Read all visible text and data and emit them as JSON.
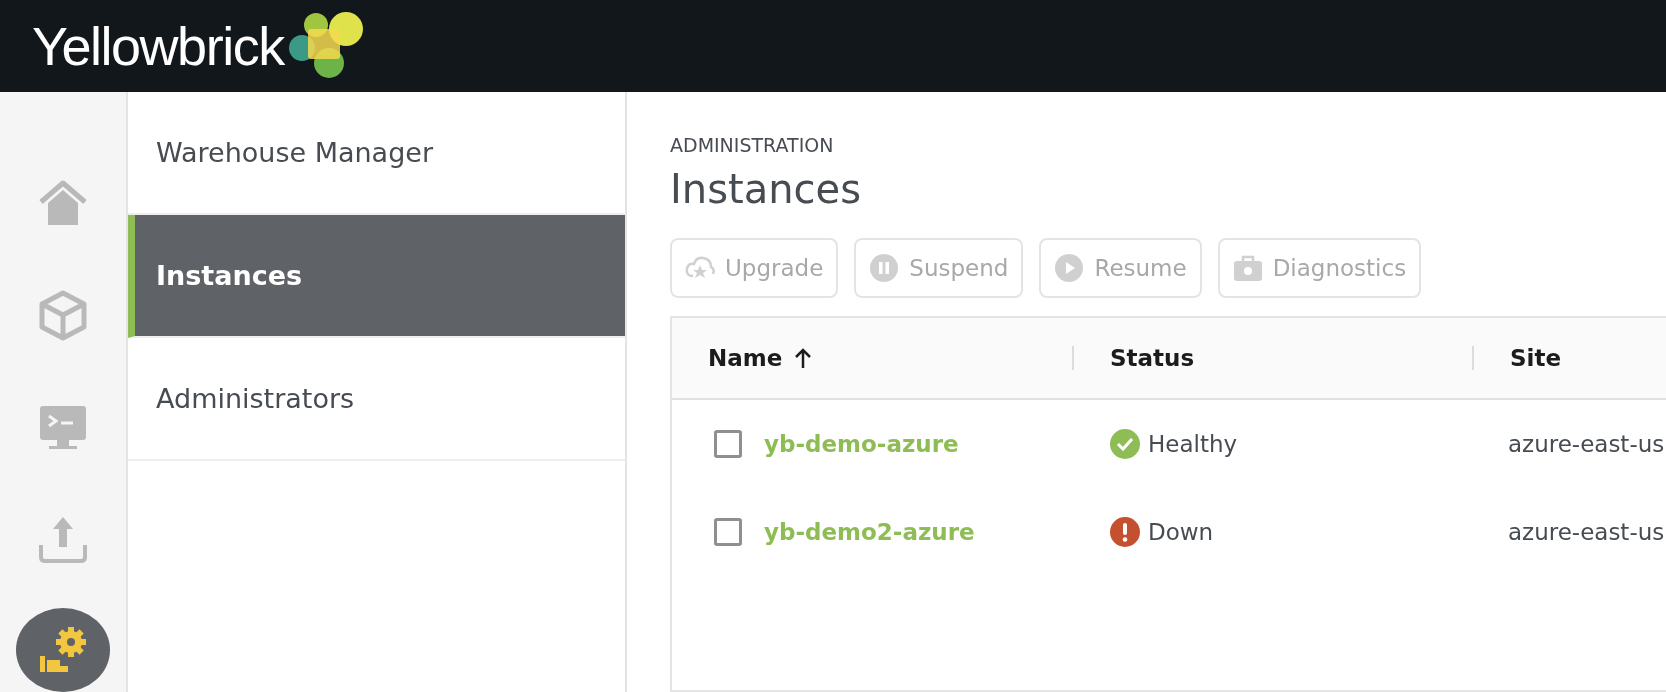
{
  "header": {
    "logo_text": "Yellowbrick"
  },
  "rail": [
    {
      "kind": "home",
      "selected": false
    },
    {
      "kind": "cube",
      "selected": false
    },
    {
      "kind": "terminal",
      "selected": false
    },
    {
      "kind": "upload",
      "selected": false
    },
    {
      "kind": "admin",
      "selected": true
    }
  ],
  "nav": [
    {
      "label": "Warehouse Manager",
      "selected": false
    },
    {
      "label": "Instances",
      "selected": true
    },
    {
      "label": "Administrators",
      "selected": false
    }
  ],
  "breadcrumb": "ADMINISTRATION",
  "title": "Instances",
  "toolbar": [
    {
      "kind": "upgrade",
      "label": "Upgrade",
      "disabled": true
    },
    {
      "kind": "suspend",
      "label": "Suspend",
      "disabled": true
    },
    {
      "kind": "resume",
      "label": "Resume",
      "disabled": true
    },
    {
      "kind": "diagnostics",
      "label": "Diagnostics",
      "disabled": true
    }
  ],
  "table": {
    "columns": [
      {
        "label": "Name",
        "sorted_ascending": true
      },
      {
        "label": "Status",
        "sorted_ascending": false
      },
      {
        "label": "Site",
        "sorted_ascending": false
      }
    ],
    "rows": [
      {
        "checked": false,
        "name": "yb-demo-azure",
        "status": {
          "kind": "healthy",
          "label": "Healthy"
        },
        "site": "azure-east-us"
      },
      {
        "checked": false,
        "name": "yb-demo2-azure",
        "status": {
          "kind": "down",
          "label": "Down"
        },
        "site": "azure-east-us"
      }
    ]
  }
}
